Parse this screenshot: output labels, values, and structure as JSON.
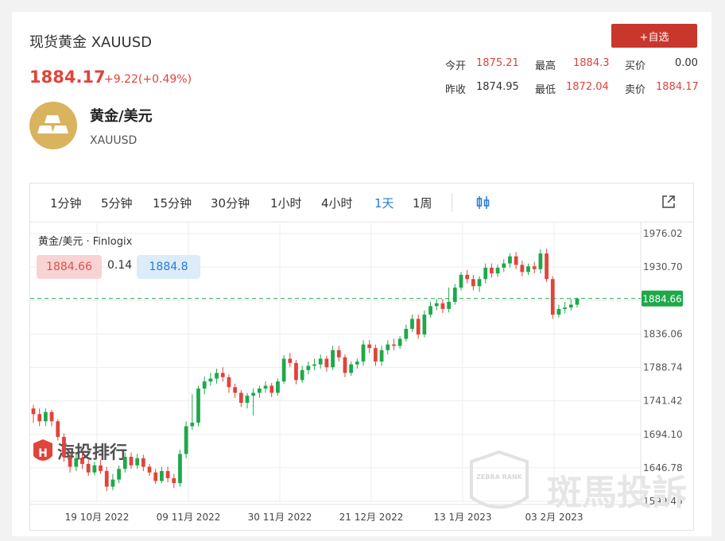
{
  "header": {
    "title": "现货黄金 XAUUSD",
    "price": "1884.17",
    "change": "+9.22(+0.49%)",
    "add_watchlist": "+自选"
  },
  "quote": {
    "open_label": "今开",
    "open": "1875.21",
    "high_label": "最高",
    "high": "1884.3",
    "bid_label": "买价",
    "bid": "0.00",
    "prev_label": "昨收",
    "prev": "1874.95",
    "low_label": "最低",
    "low": "1872.04",
    "ask_label": "卖价",
    "ask": "1884.17"
  },
  "asset": {
    "name": "黄金/美元",
    "code": "XAUUSD"
  },
  "toolbar": {
    "timeframes": [
      "1分钟",
      "5分钟",
      "15分钟",
      "30分钟",
      "1小时",
      "4小时",
      "1天",
      "1周"
    ],
    "active": "1天"
  },
  "chart_legend": {
    "series": "黄金/美元 · Finlogix",
    "bid": "1884.66",
    "spread": "0.14",
    "ask": "1884.8"
  },
  "watermarks": {
    "left": "海投排行",
    "right": "斑馬投訴",
    "badge": "ZEBRA RANK"
  },
  "colors": {
    "up": "#1fa84a",
    "down": "#e0443b",
    "accent": "#2a7ad6",
    "button": "#c9372c"
  },
  "chart_data": {
    "type": "candlestick",
    "x_tick_labels": [
      "19 10月 2022",
      "09 11月 2022",
      "30 11月 2022",
      "21 12月 2022",
      "13 1月 2023",
      "03 2月 2023"
    ],
    "y_tick_labels": [
      "1976.02",
      "1930.70",
      "1883.38",
      "1836.06",
      "1788.74",
      "1741.42",
      "1694.10",
      "1646.78",
      "1599.46"
    ],
    "ylim": [
      1599.46,
      1976.02
    ],
    "last_price": 1884.66,
    "last_price_label": "1884.66",
    "candles": [
      [
        1730,
        1722,
        1735,
        1710
      ],
      [
        1722,
        1712,
        1730,
        1705
      ],
      [
        1712,
        1725,
        1730,
        1705
      ],
      [
        1725,
        1712,
        1728,
        1705
      ],
      [
        1712,
        1690,
        1715,
        1685
      ],
      [
        1690,
        1662,
        1695,
        1655
      ],
      [
        1662,
        1648,
        1668,
        1640
      ],
      [
        1648,
        1660,
        1668,
        1642
      ],
      [
        1660,
        1652,
        1668,
        1645
      ],
      [
        1652,
        1640,
        1658,
        1635
      ],
      [
        1640,
        1650,
        1655,
        1636
      ],
      [
        1650,
        1642,
        1658,
        1638
      ],
      [
        1642,
        1620,
        1648,
        1614
      ],
      [
        1620,
        1630,
        1638,
        1615
      ],
      [
        1630,
        1645,
        1650,
        1625
      ],
      [
        1645,
        1662,
        1668,
        1640
      ],
      [
        1662,
        1650,
        1668,
        1645
      ],
      [
        1650,
        1660,
        1666,
        1645
      ],
      [
        1660,
        1648,
        1665,
        1642
      ],
      [
        1648,
        1640,
        1652,
        1635
      ],
      [
        1640,
        1628,
        1645,
        1624
      ],
      [
        1628,
        1642,
        1648,
        1625
      ],
      [
        1642,
        1632,
        1648,
        1626
      ],
      [
        1632,
        1625,
        1638,
        1618
      ],
      [
        1625,
        1666,
        1672,
        1620
      ],
      [
        1666,
        1705,
        1712,
        1660
      ],
      [
        1705,
        1710,
        1750,
        1700
      ],
      [
        1710,
        1758,
        1762,
        1705
      ],
      [
        1758,
        1768,
        1775,
        1750
      ],
      [
        1768,
        1772,
        1780,
        1762
      ],
      [
        1772,
        1780,
        1786,
        1765
      ],
      [
        1780,
        1774,
        1788,
        1768
      ],
      [
        1774,
        1760,
        1778,
        1752
      ],
      [
        1760,
        1752,
        1765,
        1745
      ],
      [
        1752,
        1738,
        1756,
        1732
      ],
      [
        1738,
        1748,
        1752,
        1730
      ],
      [
        1748,
        1752,
        1758,
        1720
      ],
      [
        1752,
        1758,
        1762,
        1745
      ],
      [
        1758,
        1762,
        1768,
        1752
      ],
      [
        1762,
        1752,
        1766,
        1746
      ],
      [
        1752,
        1768,
        1772,
        1748
      ],
      [
        1768,
        1800,
        1805,
        1765
      ],
      [
        1800,
        1794,
        1808,
        1788
      ],
      [
        1794,
        1770,
        1798,
        1764
      ],
      [
        1770,
        1784,
        1790,
        1766
      ],
      [
        1784,
        1790,
        1796,
        1778
      ],
      [
        1790,
        1792,
        1800,
        1784
      ],
      [
        1792,
        1800,
        1806,
        1786
      ],
      [
        1800,
        1788,
        1804,
        1782
      ],
      [
        1788,
        1812,
        1818,
        1784
      ],
      [
        1812,
        1802,
        1818,
        1796
      ],
      [
        1802,
        1780,
        1806,
        1774
      ],
      [
        1780,
        1792,
        1796,
        1776
      ],
      [
        1792,
        1796,
        1800,
        1786
      ],
      [
        1796,
        1820,
        1826,
        1790
      ],
      [
        1820,
        1815,
        1826,
        1808
      ],
      [
        1815,
        1796,
        1820,
        1790
      ],
      [
        1796,
        1812,
        1818,
        1790
      ],
      [
        1812,
        1820,
        1826,
        1806
      ],
      [
        1820,
        1818,
        1828,
        1812
      ],
      [
        1818,
        1828,
        1832,
        1814
      ],
      [
        1828,
        1842,
        1848,
        1824
      ],
      [
        1842,
        1856,
        1862,
        1838
      ],
      [
        1856,
        1834,
        1862,
        1828
      ],
      [
        1834,
        1862,
        1868,
        1830
      ],
      [
        1862,
        1874,
        1880,
        1858
      ],
      [
        1874,
        1878,
        1884,
        1868
      ],
      [
        1878,
        1870,
        1884,
        1864
      ],
      [
        1870,
        1880,
        1900,
        1865
      ],
      [
        1880,
        1900,
        1905,
        1876
      ],
      [
        1900,
        1918,
        1922,
        1896
      ],
      [
        1918,
        1912,
        1925,
        1906
      ],
      [
        1912,
        1902,
        1918,
        1896
      ],
      [
        1902,
        1912,
        1916,
        1894
      ],
      [
        1912,
        1928,
        1934,
        1906
      ],
      [
        1928,
        1920,
        1934,
        1914
      ],
      [
        1920,
        1928,
        1932,
        1915
      ],
      [
        1928,
        1934,
        1940,
        1922
      ],
      [
        1934,
        1944,
        1948,
        1928
      ],
      [
        1944,
        1932,
        1950,
        1926
      ],
      [
        1932,
        1922,
        1938,
        1916
      ],
      [
        1922,
        1930,
        1934,
        1918
      ],
      [
        1930,
        1926,
        1936,
        1920
      ],
      [
        1926,
        1948,
        1954,
        1920
      ],
      [
        1948,
        1912,
        1955,
        1908
      ],
      [
        1912,
        1862,
        1916,
        1856
      ],
      [
        1862,
        1870,
        1876,
        1858
      ],
      [
        1870,
        1872,
        1880,
        1864
      ],
      [
        1872,
        1876,
        1884,
        1868
      ],
      [
        1876,
        1884.66,
        1886,
        1872
      ]
    ]
  }
}
